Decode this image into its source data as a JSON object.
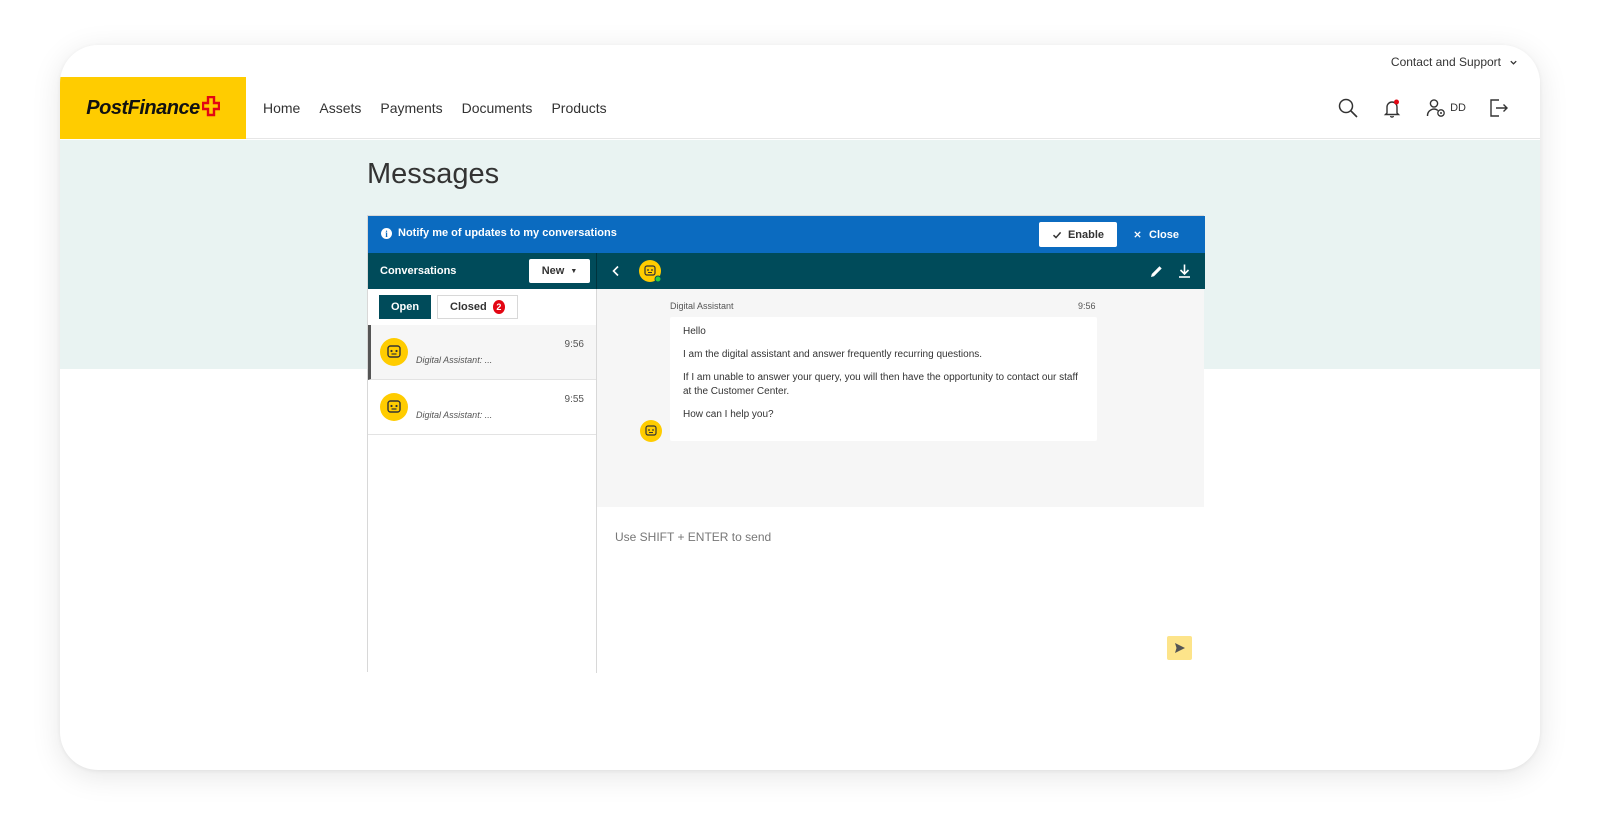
{
  "utility": {
    "contact_support": "Contact and Support"
  },
  "brand": {
    "name": "PostFinance",
    "color": "#ffcc00"
  },
  "nav": {
    "items": [
      {
        "label": "Home"
      },
      {
        "label": "Assets"
      },
      {
        "label": "Payments"
      },
      {
        "label": "Documents"
      },
      {
        "label": "Products"
      }
    ],
    "user_initials": "DD",
    "icons": [
      "search-icon",
      "bell-icon",
      "user-icon",
      "logout-icon"
    ]
  },
  "page": {
    "title": "Messages"
  },
  "notify_bar": {
    "text": "Notify me of updates to my conversations",
    "enable_label": "Enable",
    "close_label": "Close",
    "color": "#0b6bc0"
  },
  "conversations": {
    "title": "Conversations",
    "new_label": "New",
    "tabs": [
      {
        "label": "Open",
        "active": true
      },
      {
        "label": "Closed",
        "badge": "2"
      }
    ],
    "items": [
      {
        "preview": "Digital Assistant: ...",
        "time": "9:56",
        "selected": true
      },
      {
        "preview": "Digital Assistant: ...",
        "time": "9:55",
        "selected": false
      }
    ],
    "header_color": "#004b5a"
  },
  "chat": {
    "sender": "Digital Assistant",
    "time": "9:56",
    "lines": [
      "Hello",
      "I am the digital assistant and answer frequently recurring questions.",
      "If I am unable to answer your query, you will then have the opportunity to contact our staff at the Customer Center.",
      "How can I help you?"
    ],
    "input_placeholder": "Use SHIFT + ENTER to send"
  }
}
